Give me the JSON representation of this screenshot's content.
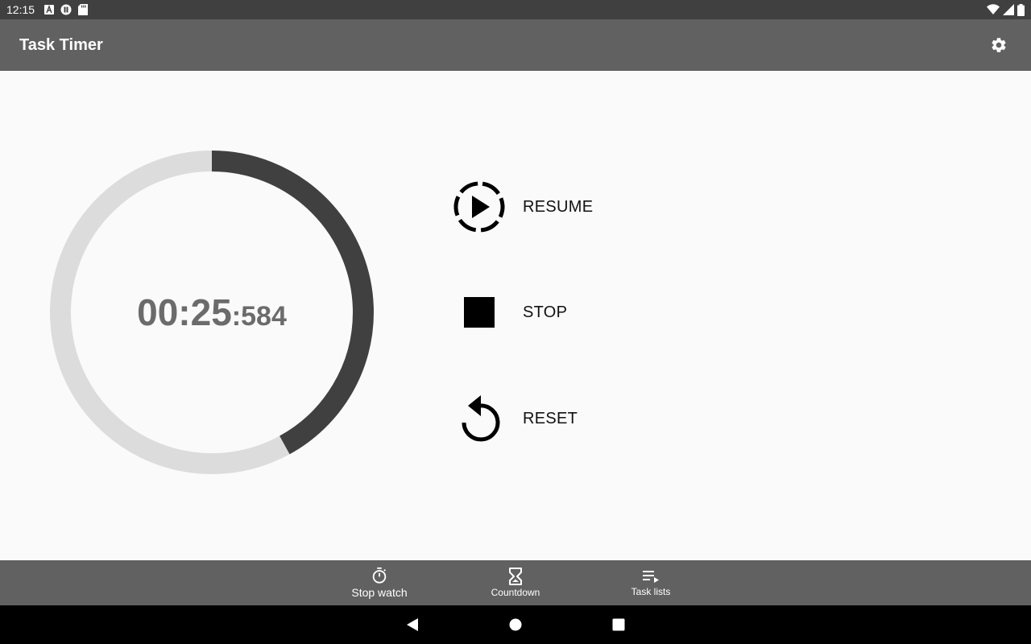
{
  "status_bar": {
    "time": "12:15",
    "notification_icons": [
      "font-icon",
      "opera-icon",
      "sd-card-icon"
    ],
    "right_icons": [
      "wifi-icon",
      "signal-icon",
      "battery-icon"
    ]
  },
  "app_bar": {
    "title": "Task Timer",
    "settings_icon": "gear-icon"
  },
  "timer": {
    "main": "00:25",
    "ms": ":584",
    "progress_fraction": 0.42,
    "colors": {
      "track": "#dcdcdc",
      "progress": "#404040",
      "text": "#6b6b6b"
    }
  },
  "actions": {
    "resume_label": "RESUME",
    "stop_label": "STOP",
    "reset_label": "RESET"
  },
  "bottom_nav": {
    "items": [
      {
        "label": "Stop watch",
        "icon": "stopwatch-icon",
        "active": true
      },
      {
        "label": "Countdown",
        "icon": "hourglass-icon",
        "active": false
      },
      {
        "label": "Task lists",
        "icon": "playlist-icon",
        "active": false
      }
    ]
  },
  "system_nav": {
    "buttons": [
      "back-icon",
      "home-icon",
      "recents-icon"
    ]
  },
  "colors": {
    "app_bar": "#616161",
    "status_bar": "#404040",
    "background": "#fafafa",
    "system_nav": "#000000"
  }
}
